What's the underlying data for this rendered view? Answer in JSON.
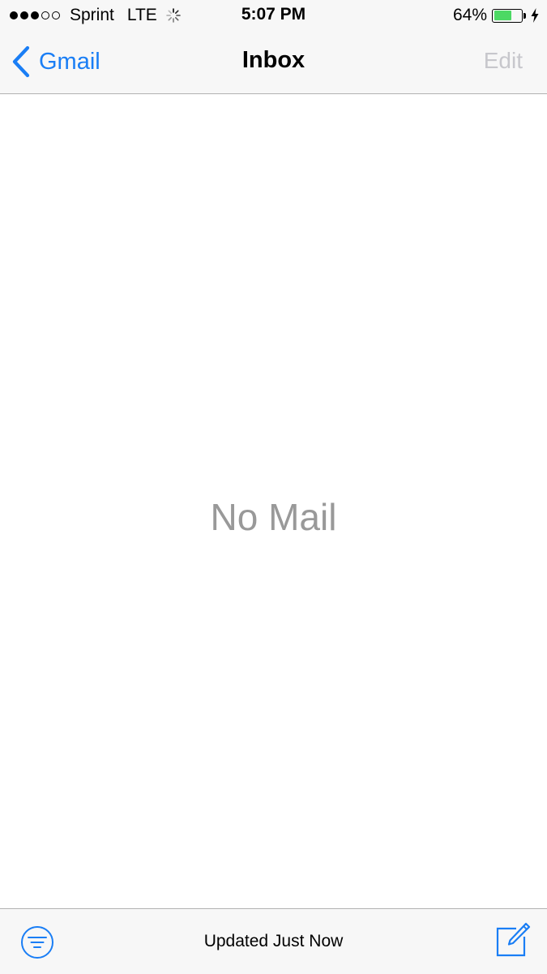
{
  "status_bar": {
    "carrier": "Sprint",
    "network": "LTE",
    "signal_bars_filled": 3,
    "signal_bars_total": 5,
    "time": "5:07 PM",
    "battery_percent_label": "64%",
    "battery_level": 0.64,
    "charging": true,
    "activity_icon": "loading-spinner-icon"
  },
  "nav": {
    "back_label": "Gmail",
    "title": "Inbox",
    "edit_label": "Edit"
  },
  "content": {
    "empty_message": "No Mail"
  },
  "toolbar": {
    "status": "Updated Just Now",
    "filter_icon": "filter-icon",
    "compose_icon": "compose-icon"
  },
  "colors": {
    "accent": "#1a7ef5",
    "battery_fill": "#4cd964",
    "disabled_text": "#c7c7cc",
    "empty_text": "#999999",
    "bar_background": "#f7f7f7"
  }
}
